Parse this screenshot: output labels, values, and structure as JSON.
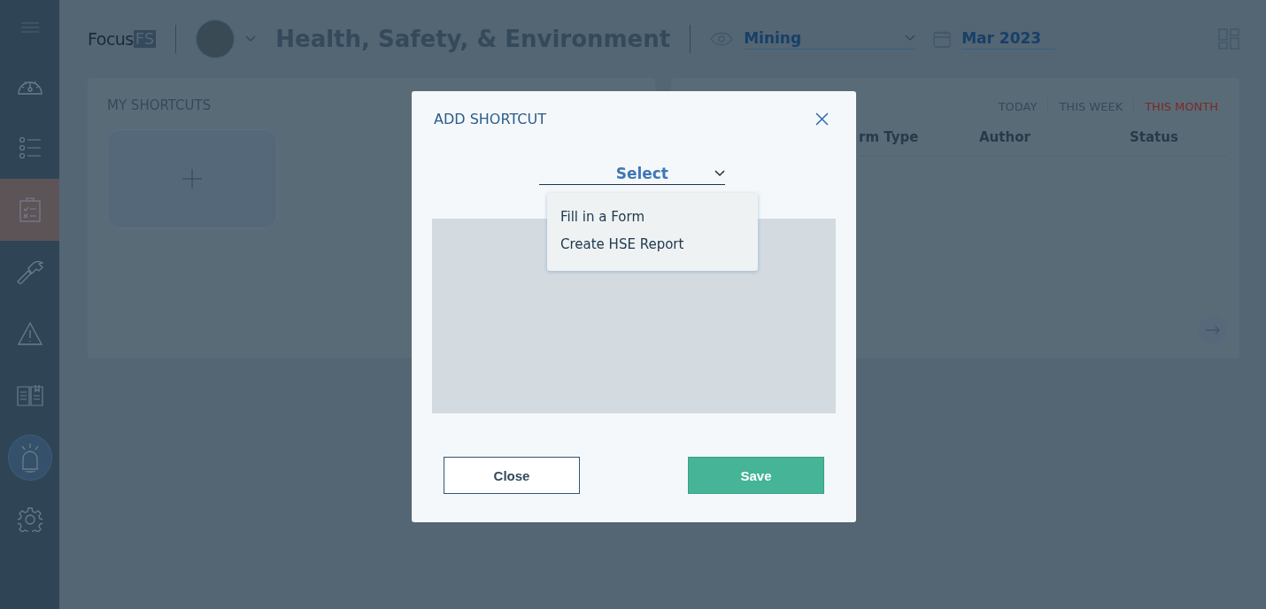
{
  "logo": {
    "text": "Focus",
    "badge": "FS"
  },
  "header": {
    "title": "Health, Safety, & Environment",
    "site": "Mining",
    "period": "Mar 2023"
  },
  "sidebar": {
    "items": [
      {
        "kind": "dashboard",
        "selected": false
      },
      {
        "kind": "list",
        "selected": false
      },
      {
        "kind": "clipboard",
        "selected": true
      },
      {
        "kind": "hammer",
        "selected": false
      },
      {
        "kind": "warning",
        "selected": false
      },
      {
        "kind": "book",
        "selected": false
      },
      {
        "kind": "alarm",
        "selected": false
      },
      {
        "kind": "gear",
        "selected": false
      }
    ]
  },
  "shortcuts": {
    "title": "MY SHORTCUTS"
  },
  "activity": {
    "tabs": [
      {
        "label": "TODAY",
        "selected": false
      },
      {
        "label": "THIS WEEK",
        "selected": false
      },
      {
        "label": "THIS MONTH",
        "selected": true
      }
    ],
    "columns": [
      "rm Type",
      "Author",
      "Status"
    ]
  },
  "dialog": {
    "title": "ADD SHORTCUT",
    "select": {
      "value": "Select",
      "options": [
        {
          "label": "Fill in a Form"
        },
        {
          "label": "Create HSE Report"
        }
      ]
    },
    "buttons": [
      {
        "kind": "secondary",
        "label": "Close"
      },
      {
        "kind": "primary",
        "label": "Save"
      }
    ]
  }
}
